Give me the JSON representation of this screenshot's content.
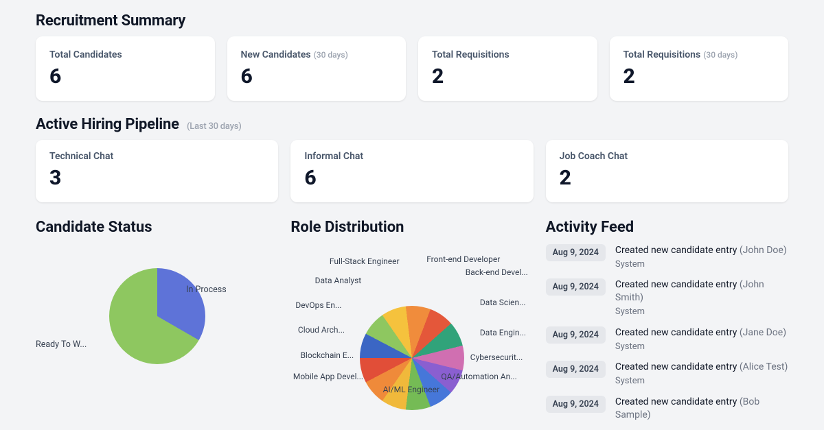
{
  "sections": {
    "summary_title": "Recruitment Summary",
    "pipeline_title": "Active Hiring Pipeline",
    "pipeline_sub": "(Last 30 days)",
    "status_title": "Candidate Status",
    "roles_title": "Role Distribution",
    "activity_title": "Activity Feed"
  },
  "summary": [
    {
      "label": "Total Candidates",
      "sub": "",
      "value": "6"
    },
    {
      "label": "New Candidates",
      "sub": "(30 days)",
      "value": "6"
    },
    {
      "label": "Total Requisitions",
      "sub": "",
      "value": "2"
    },
    {
      "label": "Total Requisitions",
      "sub": "(30 days)",
      "value": "2"
    }
  ],
  "pipeline": [
    {
      "label": "Technical Chat",
      "value": "3"
    },
    {
      "label": "Informal Chat",
      "value": "6"
    },
    {
      "label": "Job Coach Chat",
      "value": "2"
    }
  ],
  "status_labels": {
    "in_process": "In Process",
    "ready": "Ready To W..."
  },
  "role_labels": {
    "front": "Front-end Developer",
    "back": "Back-end Devel...",
    "datasci": "Data Scien...",
    "dataeng": "Data Engin...",
    "cyber": "Cybersecurit...",
    "qa": "QA/Automation An...",
    "aiml": "AI/ML Engineer",
    "mobile": "Mobile App Devel...",
    "blockchain": "Blockchain E...",
    "cloud": "Cloud Arch...",
    "devops": "DevOps En...",
    "analyst": "Data Analyst",
    "fullstack": "Full-Stack Engineer"
  },
  "activity": [
    {
      "date": "Aug 9, 2024",
      "text": "Created new candidate entry",
      "name": "John Doe",
      "actor": "System"
    },
    {
      "date": "Aug 9, 2024",
      "text": "Created new candidate entry",
      "name": "John Smith",
      "actor": "System"
    },
    {
      "date": "Aug 9, 2024",
      "text": "Created new candidate entry",
      "name": "Jane Doe",
      "actor": "System"
    },
    {
      "date": "Aug 9, 2024",
      "text": "Created new candidate entry",
      "name": "Alice Test",
      "actor": "System"
    },
    {
      "date": "Aug 9, 2024",
      "text": "Created new candidate entry",
      "name": "Bob Sample",
      "actor": ""
    }
  ],
  "colors": {
    "status": {
      "in_process": "#5e73d8",
      "ready": "#8ec760"
    },
    "roles": [
      "#3b66c4",
      "#8ec760",
      "#f5c23d",
      "#f08c3c",
      "#e4573a",
      "#31a37a",
      "#d06fb1",
      "#8a5fd0",
      "#4677d9",
      "#75bb55",
      "#f0b93b",
      "#ef8a3a",
      "#e14e38"
    ]
  },
  "chart_data": [
    {
      "type": "pie",
      "title": "Candidate Status",
      "series": [
        {
          "name": "In Process",
          "value": 2
        },
        {
          "name": "Ready To Work",
          "value": 4
        }
      ],
      "note": "values estimated from slice angles; In Process ≈ 1/3, Ready To Work ≈ 2/3; total candidates = 6"
    },
    {
      "type": "pie",
      "title": "Role Distribution",
      "categories": [
        "Front-end Developer",
        "Back-end Developer",
        "Data Scientist",
        "Data Engineer",
        "Cybersecurity",
        "QA/Automation Analyst",
        "AI/ML Engineer",
        "Mobile App Developer",
        "Blockchain Engineer",
        "Cloud Architect",
        "DevOps Engineer",
        "Data Analyst",
        "Full-Stack Engineer"
      ],
      "values": [
        1,
        1,
        1,
        1,
        1,
        1,
        1,
        1,
        1,
        1,
        1,
        1,
        1
      ],
      "note": "13 equal slices visually"
    }
  ]
}
